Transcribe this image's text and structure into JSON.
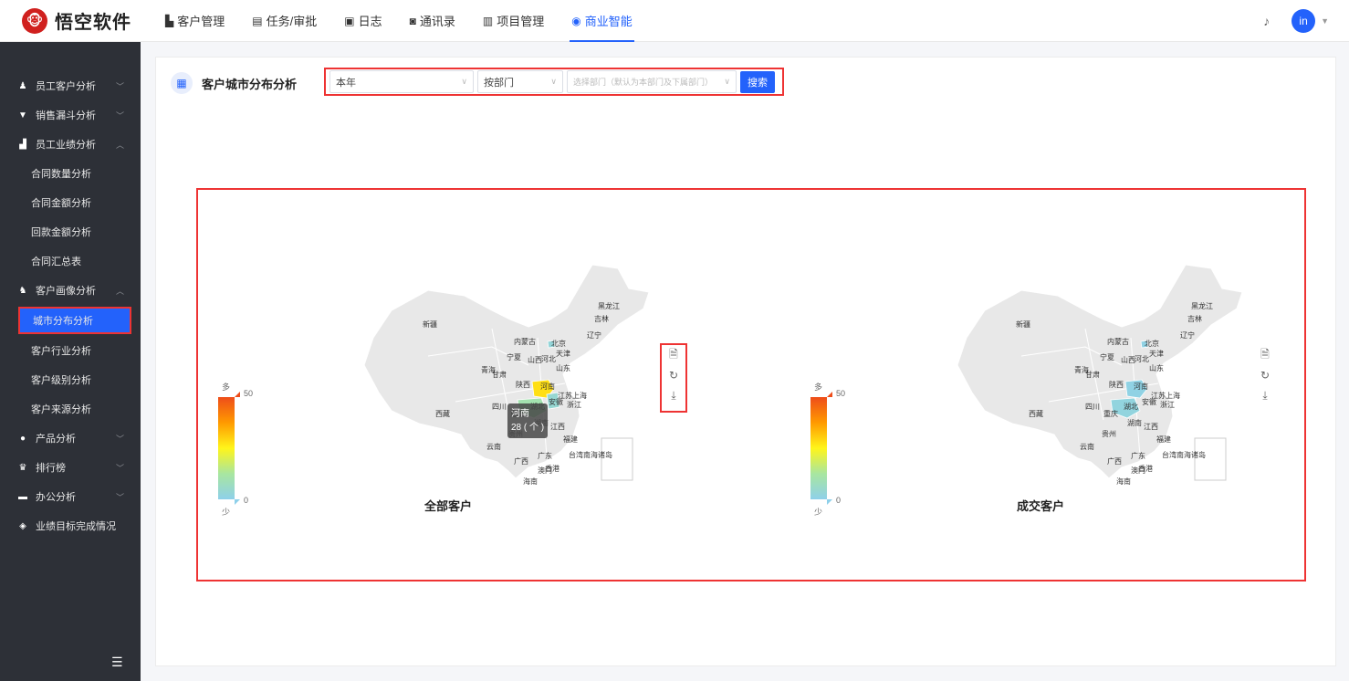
{
  "app": {
    "name": "悟空软件",
    "logo_glyph": "🐵"
  },
  "nav": [
    {
      "icon": "bar-chart-icon",
      "glyph": "▙",
      "label": "客户管理",
      "active": false
    },
    {
      "icon": "briefcase-icon",
      "glyph": "▤",
      "label": "任务/审批",
      "active": false
    },
    {
      "icon": "journal-icon",
      "glyph": "▣",
      "label": "日志",
      "active": false
    },
    {
      "icon": "contacts-icon",
      "glyph": "◙",
      "label": "通讯录",
      "active": false
    },
    {
      "icon": "project-icon",
      "glyph": "▥",
      "label": "项目管理",
      "active": false
    },
    {
      "icon": "bi-icon",
      "glyph": "◉",
      "label": "商业智能",
      "active": true
    }
  ],
  "user": {
    "avatar_text": "in"
  },
  "sidebar": {
    "groups": [
      {
        "label": "员工客户分析",
        "glyph": "♟",
        "expanded": false,
        "children": []
      },
      {
        "label": "销售漏斗分析",
        "glyph": "▼",
        "expanded": false,
        "children": []
      },
      {
        "label": "员工业绩分析",
        "glyph": "▟",
        "expanded": true,
        "children": [
          "合同数量分析",
          "合同金额分析",
          "回款金额分析",
          "合同汇总表"
        ]
      },
      {
        "label": "客户画像分析",
        "glyph": "♞",
        "expanded": true,
        "children": [
          "城市分布分析",
          "客户行业分析",
          "客户级别分析",
          "客户来源分析"
        ]
      },
      {
        "label": "产品分析",
        "glyph": "●",
        "expanded": false,
        "children": []
      },
      {
        "label": "排行榜",
        "glyph": "♛",
        "expanded": false,
        "children": []
      },
      {
        "label": "办公分析",
        "glyph": "▬",
        "expanded": false,
        "children": []
      },
      {
        "label": "业绩目标完成情况",
        "glyph": "◈",
        "expanded": false,
        "children": []
      }
    ],
    "active_item": "城市分布分析"
  },
  "page": {
    "title": "客户城市分布分析",
    "filters": {
      "period": "本年",
      "scope": "按部门",
      "dept_placeholder": "选择部门（默认为本部门及下属部门）",
      "search_label": "搜索"
    }
  },
  "chart_data": [
    {
      "type": "heatmap",
      "title": "全部客户",
      "legend": {
        "max_label": "多",
        "min_label": "少",
        "max": 50,
        "min": 0
      },
      "regions": [
        {
          "name": "河南",
          "value": 28
        },
        {
          "name": "湖北",
          "value": 10
        },
        {
          "name": "北京",
          "value": 3
        },
        {
          "name": "安徽",
          "value": 4
        }
      ],
      "tooltip": {
        "name": "河南",
        "value": "28 ( 个 )"
      }
    },
    {
      "type": "heatmap",
      "title": "成交客户",
      "legend": {
        "max_label": "多",
        "min_label": "少",
        "max": 50,
        "min": 0
      },
      "regions": [
        {
          "name": "湖北",
          "value": 2
        },
        {
          "name": "河南",
          "value": 1
        },
        {
          "name": "北京",
          "value": 1
        }
      ]
    }
  ],
  "province_labels": [
    "新疆",
    "西藏",
    "青海",
    "甘肃",
    "内蒙古",
    "宁夏",
    "陕西",
    "四川",
    "重庆",
    "云南",
    "贵州",
    "广西",
    "广东",
    "湖南",
    "湖北",
    "河南",
    "山西",
    "河北",
    "北京",
    "天津",
    "山东",
    "江苏",
    "安徽",
    "浙江",
    "江西",
    "福建",
    "台湾",
    "海南",
    "澳门",
    "香港",
    "辽宁",
    "吉林",
    "黑龙江",
    "上海",
    "南海诸岛"
  ],
  "toolbox": [
    {
      "icon": "data-view-icon",
      "glyph": "🗎"
    },
    {
      "icon": "refresh-icon",
      "glyph": "↻"
    },
    {
      "icon": "download-icon",
      "glyph": "⤓"
    }
  ],
  "colors": {
    "accent": "#2362fb",
    "sidebar_bg": "#2d3037",
    "highlight_border": "#ee3333",
    "map_fill": "#e8e8e8"
  }
}
